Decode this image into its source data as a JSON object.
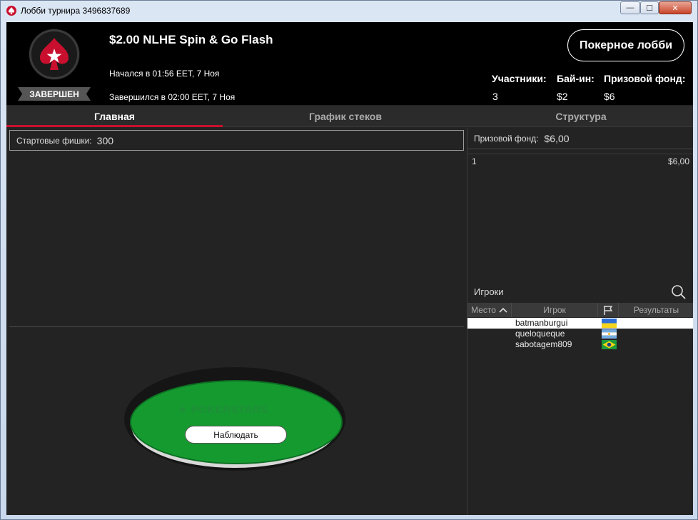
{
  "window": {
    "title": "Лобби турнира 3496837689",
    "min_label": "—",
    "max_label": "☐",
    "close_label": "✕"
  },
  "header": {
    "tournament_name": "$2.00 NLHE Spin & Go Flash",
    "started": "Начался в 01:56 EET, 7 Ноя",
    "ended": "Завершился в 02:00 EET, 7 Ноя",
    "status": "ЗАВЕРШЕН",
    "lobby_button": "Покерное лобби",
    "participants_label": "Участники:",
    "participants_value": "3",
    "buyin_label": "Бай-ин:",
    "buyin_value": "$2",
    "prizepool_label": "Призовой фонд:",
    "prizepool_value": "$6"
  },
  "tabs": [
    {
      "label": "Главная",
      "active": true
    },
    {
      "label": "График стеков",
      "active": false
    },
    {
      "label": "Структура",
      "active": false
    }
  ],
  "main": {
    "starting_chips_label": "Стартовые фишки:",
    "starting_chips_value": "300",
    "table_logo": "POKERSTARS",
    "watch_button": "Наблюдать"
  },
  "prizes": {
    "label": "Призовой фонд:",
    "value": "$6,00",
    "rows": [
      {
        "place": "1",
        "amount": "$6,00"
      }
    ]
  },
  "players": {
    "title": "Игроки",
    "columns": [
      "Место",
      "Игрок",
      "Результаты"
    ],
    "rows": [
      {
        "place": "",
        "name": "batmanburgui",
        "flag": "ukraine",
        "result": ""
      },
      {
        "place": "",
        "name": "queloqueque",
        "flag": "argentina",
        "result": ""
      },
      {
        "place": "",
        "name": "sabotagem809",
        "flag": "brazil",
        "result": ""
      }
    ]
  },
  "colors": {
    "accent_red": "#c8102e",
    "felt_green": "#159a30",
    "background": "#232323"
  },
  "icons": {
    "app": "pokerstars-spade-icon",
    "search": "search-icon",
    "sort": "chevron-up-icon",
    "flag_column": "flag-icon"
  }
}
